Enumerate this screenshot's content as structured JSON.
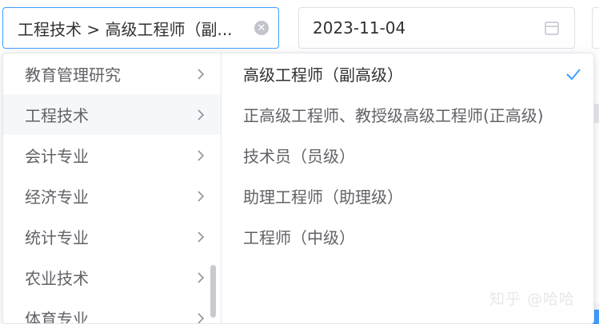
{
  "cascader": {
    "value": "工程技术 > 高级工程师（副..."
  },
  "date_picker": {
    "value": "2023-11-04"
  },
  "menu_left": [
    {
      "label": "教育管理研究",
      "active": false
    },
    {
      "label": "工程技术",
      "active": true
    },
    {
      "label": "会计专业",
      "active": false
    },
    {
      "label": "经济专业",
      "active": false
    },
    {
      "label": "统计专业",
      "active": false
    },
    {
      "label": "农业技术",
      "active": false
    },
    {
      "label": "体育专业",
      "active": false
    }
  ],
  "menu_right": [
    {
      "label": "高级工程师（副高级）",
      "selected": true
    },
    {
      "label": "正高级工程师、教授级高级工程师(正高级)",
      "selected": false
    },
    {
      "label": "技术员（员级）",
      "selected": false
    },
    {
      "label": "助理工程师（助理级）",
      "selected": false
    },
    {
      "label": "工程师（中级）",
      "selected": false
    }
  ],
  "watermark": "知乎 @哈哈",
  "colors": {
    "accent": "#409eff",
    "text": "#606266",
    "active_bg": "#f5f7fa"
  },
  "icons": {
    "clear": "circle-close-icon",
    "calendar": "calendar-icon",
    "chevron": "chevron-right-icon",
    "check": "check-icon"
  }
}
